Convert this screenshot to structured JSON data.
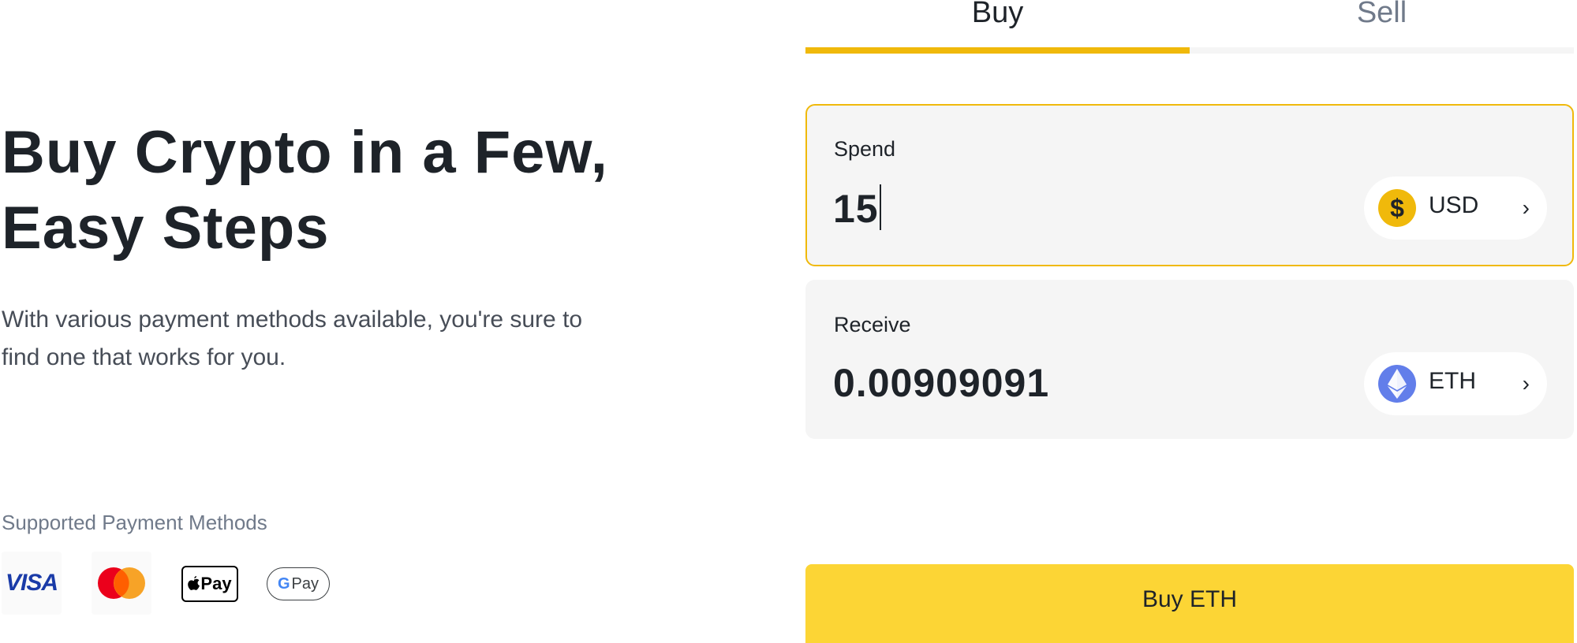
{
  "hero": {
    "title": "Buy Crypto in a Few, Easy Steps",
    "subtitle": "With various payment methods available, you're sure to find one that works for you."
  },
  "payment_methods": {
    "title": "Supported Payment Methods",
    "items": [
      {
        "name": "VISA",
        "icon": "visa-logo"
      },
      {
        "name": "Mastercard",
        "icon": "mastercard-logo"
      },
      {
        "name": "Pay",
        "icon": "apple-pay-logo"
      },
      {
        "name": "Pay",
        "icon": "google-pay-logo"
      }
    ]
  },
  "tabs": [
    {
      "label": "Buy",
      "active": true
    },
    {
      "label": "Sell",
      "active": false
    }
  ],
  "spend": {
    "label": "Spend",
    "value": "15",
    "currency": "USD",
    "currency_icon": "$"
  },
  "receive": {
    "label": "Receive",
    "value": "0.00909091",
    "currency": "ETH",
    "currency_icon": "ethereum-icon"
  },
  "cta": {
    "label": "Buy ETH"
  },
  "colors": {
    "accent": "#f0b90b",
    "button": "#fcd535",
    "text_primary": "#1e2329",
    "text_secondary": "#707a8a",
    "field_bg": "#f5f5f5",
    "eth": "#627eea"
  }
}
